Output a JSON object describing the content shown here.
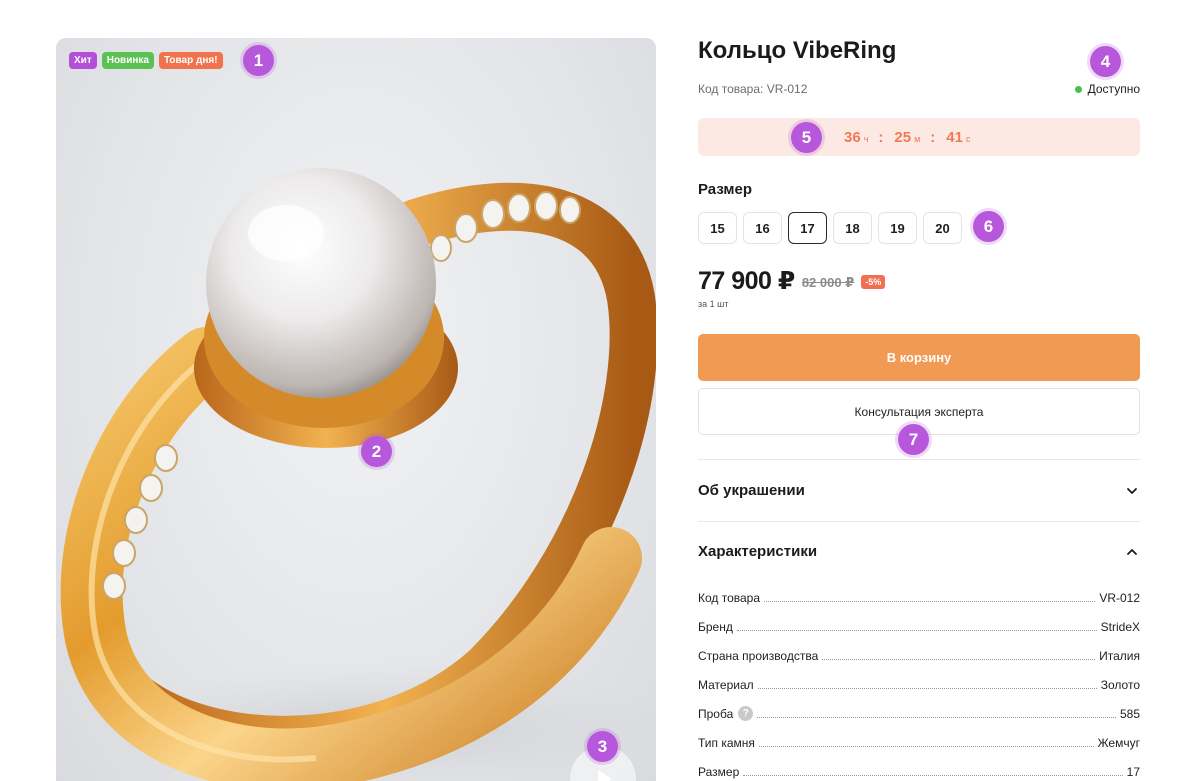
{
  "gallery": {
    "badges": [
      {
        "label": "Хит",
        "color": "#b54fd9"
      },
      {
        "label": "Новинка",
        "color": "#5cc153"
      },
      {
        "label": "Товар дня!",
        "color": "#f0734d"
      }
    ],
    "image_subject": "gold-pearl-ring",
    "video_icon": "play-icon"
  },
  "product": {
    "title": "Кольцо VibeRing",
    "sku_label": "Код товара: VR-012",
    "availability": "Доступно",
    "availability_color": "#3ec64a"
  },
  "timer": {
    "hours": "36",
    "hours_unit": "ч",
    "minutes": "25",
    "minutes_unit": "м",
    "seconds": "41",
    "seconds_unit": "с",
    "separator": ":"
  },
  "size": {
    "label": "Размер",
    "options": [
      "15",
      "16",
      "17",
      "18",
      "19",
      "20"
    ],
    "selected": "17"
  },
  "price": {
    "current": "77 900 ₽",
    "old": "82 000 ₽",
    "discount": "-5%",
    "per_unit": "за 1 шт"
  },
  "actions": {
    "cart": "В корзину",
    "consult": "Консультация эксперта",
    "accent_color": "#f09a54"
  },
  "accordion": {
    "about": "Об украшении",
    "specs": "Характеристики"
  },
  "specs": [
    {
      "key": "Код товара",
      "value": "VR-012"
    },
    {
      "key": "Бренд",
      "value": "StrideX"
    },
    {
      "key": "Страна производства",
      "value": "Италия"
    },
    {
      "key": "Материал",
      "value": "Золото"
    },
    {
      "key": "Проба",
      "value": "585",
      "help": "?"
    },
    {
      "key": "Тип камня",
      "value": "Жемчуг"
    },
    {
      "key": "Размер",
      "value": "17"
    }
  ],
  "markers": [
    "1",
    "2",
    "3",
    "4",
    "5",
    "6",
    "7"
  ]
}
